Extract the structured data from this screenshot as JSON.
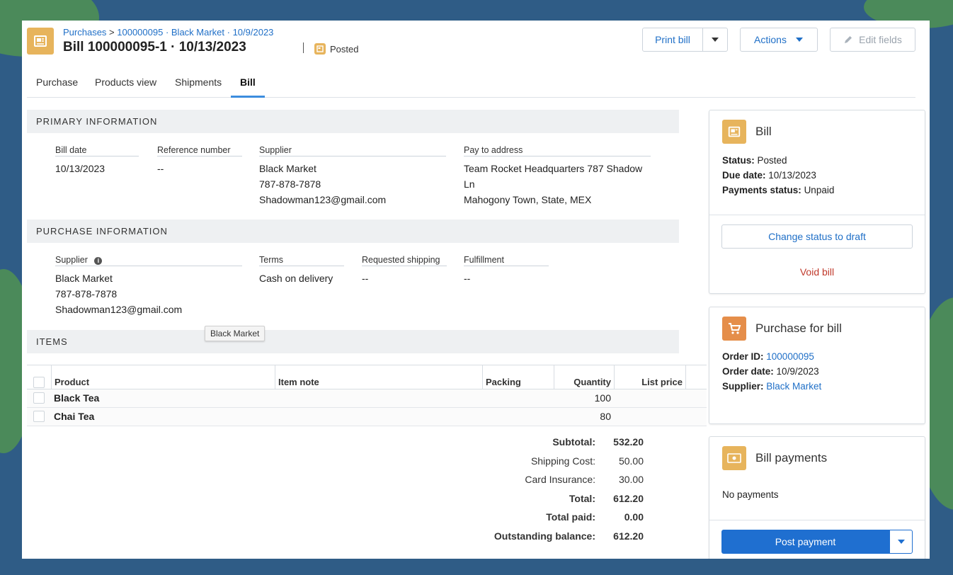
{
  "header": {
    "breadcrumb_root": "Purchases",
    "breadcrumb_sep": ">",
    "breadcrumb_order": "100000095 · Black Market · 10/9/2023",
    "title": "Bill 100000095-1 · 10/13/2023",
    "status": "Posted",
    "print_label": "Print bill",
    "actions_label": "Actions",
    "edit_label": "Edit fields"
  },
  "tabs": [
    {
      "label": "Purchase",
      "active": false
    },
    {
      "label": "Products view",
      "active": false
    },
    {
      "label": "Shipments",
      "active": false
    },
    {
      "label": "Bill",
      "active": true
    }
  ],
  "primary": {
    "section_title": "PRIMARY INFORMATION",
    "bill_date_label": "Bill date",
    "bill_date": "10/13/2023",
    "ref_label": "Reference number",
    "ref_value": "--",
    "supplier_label": "Supplier",
    "supplier_name": "Black Market",
    "supplier_phone": "787-878-7878",
    "supplier_email": "Shadowman123@gmail.com",
    "pay_label": "Pay to address",
    "pay_line1": "Team Rocket Headquarters 787 Shadow",
    "pay_line2": "Ln",
    "pay_line3": "Mahogony Town, State, MEX"
  },
  "purchase": {
    "section_title": "PURCHASE INFORMATION",
    "supplier_label": "Supplier",
    "supplier_name": "Black Market",
    "supplier_phone": "787-878-7878",
    "supplier_email": "Shadowman123@gmail.com",
    "terms_label": "Terms",
    "terms_value": "Cash on delivery",
    "shipping_label": "Requested shipping",
    "shipping_value": "--",
    "fulfillment_label": "Fulfillment",
    "fulfillment_value": "--"
  },
  "tooltip": "Black Market",
  "items": {
    "section_title": "ITEMS",
    "columns": {
      "product": "Product",
      "note": "Item note",
      "packing": "Packing",
      "quantity": "Quantity",
      "list_price": "List price"
    },
    "rows": [
      {
        "product": "Black Tea",
        "quantity": "100"
      },
      {
        "product": "Chai Tea",
        "quantity": "80"
      }
    ]
  },
  "totals": {
    "subtotal_label": "Subtotal:",
    "subtotal": "532.20",
    "shipping_label": "Shipping Cost:",
    "shipping": "50.00",
    "insurance_label": "Card Insurance:",
    "insurance": "30.00",
    "total_label": "Total:",
    "total": "612.20",
    "paid_label": "Total paid:",
    "paid": "0.00",
    "balance_label": "Outstanding balance:",
    "balance": "612.20"
  },
  "bill_panel": {
    "title": "Bill",
    "status_label": "Status:",
    "status": "Posted",
    "due_label": "Due date:",
    "due": "10/13/2023",
    "payments_label": "Payments status:",
    "payments": "Unpaid",
    "change_btn": "Change status to draft",
    "void_btn": "Void bill"
  },
  "purchase_panel": {
    "title": "Purchase for bill",
    "order_id_label": "Order ID:",
    "order_id": "100000095",
    "order_date_label": "Order date:",
    "order_date": "10/9/2023",
    "supplier_label": "Supplier:",
    "supplier": "Black Market"
  },
  "payments_panel": {
    "title": "Bill payments",
    "empty": "No payments",
    "post_btn": "Post payment"
  },
  "colors": {
    "accent": "#1f6fc7",
    "bill_icon": "#e7b45c",
    "cart_icon": "#e58e4a",
    "danger": "#c0392b",
    "primary_button": "#1f6fd0"
  }
}
